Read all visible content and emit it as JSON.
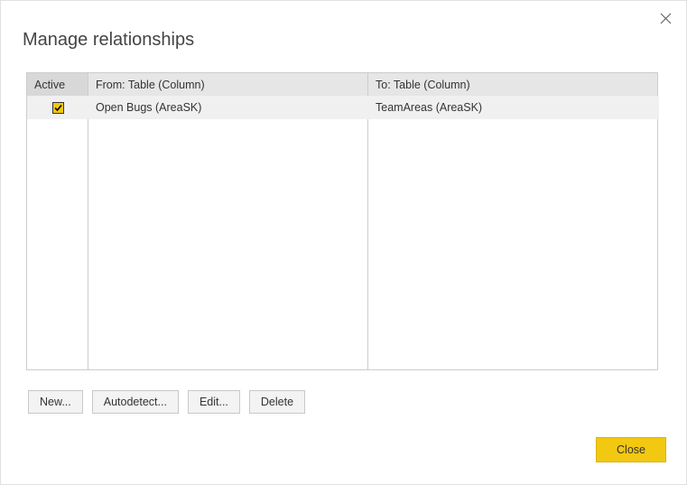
{
  "dialog": {
    "title": "Manage relationships"
  },
  "table": {
    "headers": {
      "active": "Active",
      "from": "From: Table (Column)",
      "to": "To: Table (Column)"
    },
    "rows": [
      {
        "active": true,
        "from": "Open Bugs (AreaSK)",
        "to": "TeamAreas (AreaSK)"
      }
    ]
  },
  "buttons": {
    "new": "New...",
    "autodetect": "Autodetect...",
    "edit": "Edit...",
    "delete": "Delete",
    "close": "Close"
  }
}
